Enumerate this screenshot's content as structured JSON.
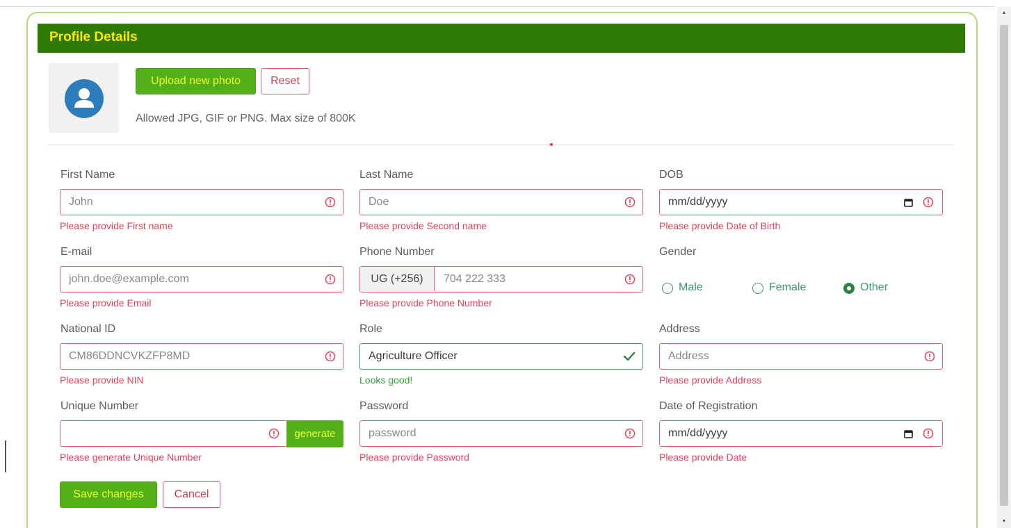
{
  "header": {
    "title": "Profile Details"
  },
  "photo": {
    "upload_label": "Upload new photo",
    "reset_label": "Reset",
    "hint": "Allowed JPG, GIF or PNG. Max size of 800K"
  },
  "fields": {
    "first_name": {
      "label": "First Name",
      "value": "John",
      "error": "Please provide First name"
    },
    "last_name": {
      "label": "Last Name",
      "value": "Doe",
      "error": "Please provide Second name"
    },
    "dob": {
      "label": "DOB",
      "value": "mm/dd/yyyy",
      "error": "Please provide Date of Birth"
    },
    "email": {
      "label": "E-mail",
      "value": "john.doe@example.com",
      "error": "Please provide Email"
    },
    "phone": {
      "label": "Phone Number",
      "prefix": "UG (+256)",
      "value": "704 222 333",
      "error": "Please provide Phone Number"
    },
    "gender": {
      "label": "Gender",
      "options": [
        "Male",
        "Female",
        "Other"
      ],
      "selected": "Other"
    },
    "national_id": {
      "label": "National ID",
      "value": "CM86DDNCVKZFP8MD",
      "error": "Please provide NIN"
    },
    "role": {
      "label": "Role",
      "value": "Agriculture Officer",
      "feedback": "Looks good!"
    },
    "address": {
      "label": "Address",
      "placeholder": "Address",
      "error": "Please provide Address"
    },
    "unique_number": {
      "label": "Unique Number",
      "value": "",
      "generate_label": "generate",
      "error": "Please generate Unique Number"
    },
    "password": {
      "label": "Password",
      "placeholder": "password",
      "error": "Please provide Password"
    },
    "registration_date": {
      "label": "Date of Registration",
      "value": "mm/dd/yyyy",
      "error": "Please provide Date"
    }
  },
  "actions": {
    "save_label": "Save changes",
    "cancel_label": "Cancel"
  },
  "colors": {
    "header_bg": "#2f7a06",
    "header_text": "#ffe600",
    "primary_button": "#54b018",
    "error": "#e0435a",
    "valid": "#3a9a3a"
  },
  "icons": [
    "user-icon",
    "error-icon",
    "calendar-icon",
    "check-icon"
  ]
}
